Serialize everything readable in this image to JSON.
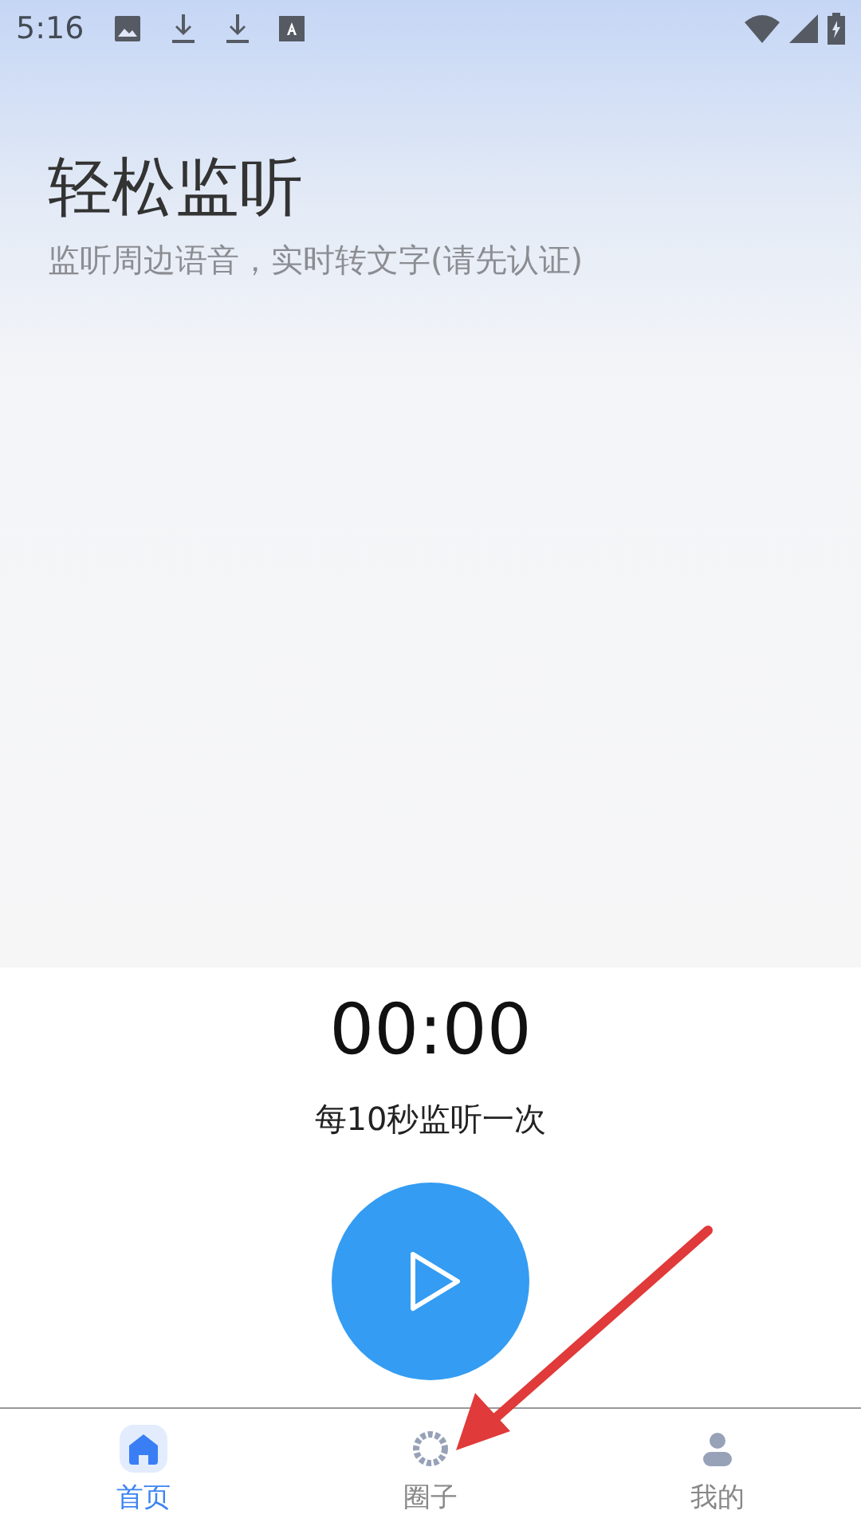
{
  "status_bar": {
    "time": "5:16"
  },
  "header": {
    "title": "轻松监听",
    "subtitle": "监听周边语音，实时转文字(请先认证)"
  },
  "monitor": {
    "timer": "00:00",
    "interval": "每10秒监听一次",
    "playing": false
  },
  "tabs": [
    {
      "label": "首页",
      "selected": true
    },
    {
      "label": "圈子",
      "selected": false
    },
    {
      "label": "我的",
      "selected": false
    }
  ]
}
